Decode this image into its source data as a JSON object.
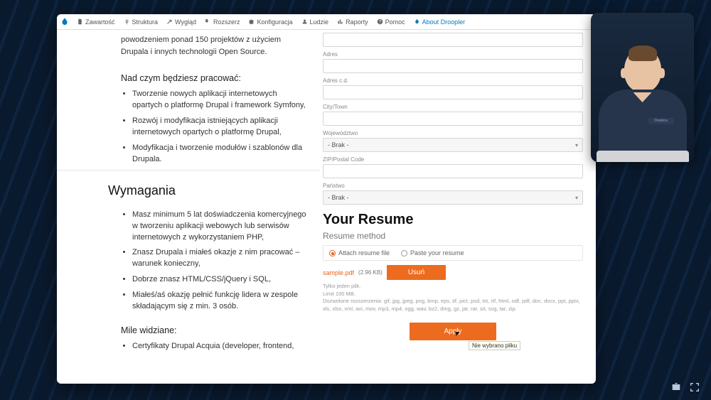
{
  "admin_bar": {
    "items": [
      {
        "label": "Zawartość"
      },
      {
        "label": "Struktura"
      },
      {
        "label": "Wygląd"
      },
      {
        "label": "Rozszerz"
      },
      {
        "label": "Konfiguracja"
      },
      {
        "label": "Ludzie"
      },
      {
        "label": "Raporty"
      },
      {
        "label": "Pomoc"
      }
    ],
    "about": "About Droopler"
  },
  "left": {
    "pretext": "powodzeniem ponad 150 projektów z użyciem Drupala i innych technologii Open Source.",
    "h_work": "Nad czym będziesz pracować:",
    "work_items": [
      "Tworzenie nowych aplikacji internetowych opartych o platformę Drupal i framework Symfony,",
      "Rozwój i modyfikacja istniejących aplikacji internetowych opartych o platformę Drupal,",
      "Modyfikacja i tworzenie modułów i szablonów dla Drupala."
    ],
    "h_req": "Wymagania",
    "req_items": [
      "Masz minimum 5 lat doświadczenia komercyjnego w tworzeniu aplikacji webowych lub serwisów internetowych z wykorzystaniem PHP,",
      "Znasz Drupala i miałeś okazje z nim pracować – warunek konieczny,",
      "Dobrze znasz HTML/CSS/jQuery i SQL,",
      "Miałeś/aś okazję pełnić funkcję lidera w zespole składającym się z min. 3 osób."
    ],
    "h_nice": "Mile widziane:",
    "nice_items": [
      "Certyfikaty Drupal Acquia (developer, frontend,"
    ]
  },
  "form": {
    "address_label": "Adres",
    "address2_label": "Adres c.d.",
    "city_label": "City/Town",
    "province_label": "Województwo",
    "province_value": "- Brak -",
    "zip_label": "ZIP/Postal Code",
    "country_label": "Państwo",
    "country_value": "- Brak -",
    "resume_title": "Your Resume",
    "resume_method_label": "Resume method",
    "method_attach": "Attach resume file",
    "method_paste": "Paste your resume",
    "file_name": "sample.pdf",
    "file_size": "(2.96 KB)",
    "remove_btn": "Usuń",
    "fine_1": "Tylko jeden plik.",
    "fine_2": "Limit 100 MB.",
    "fine_3": "Dozwolone rozszerzenia: gif, jpg, jpeg, png, bmp, eps, tif, pict, psd, txt, rtf, html, odf, pdf, doc, docx, ppt, pptx, xls, xlsx, xml, avi, mov, mp3, mp4, ogg, wav, bz2, dmg, gz, jar, rar, sit, svg, tar, zip.",
    "apply_btn": "Apply",
    "tooltip": "Nie wybrano pliku"
  },
  "webcam": {
    "badge": "Droptica"
  }
}
